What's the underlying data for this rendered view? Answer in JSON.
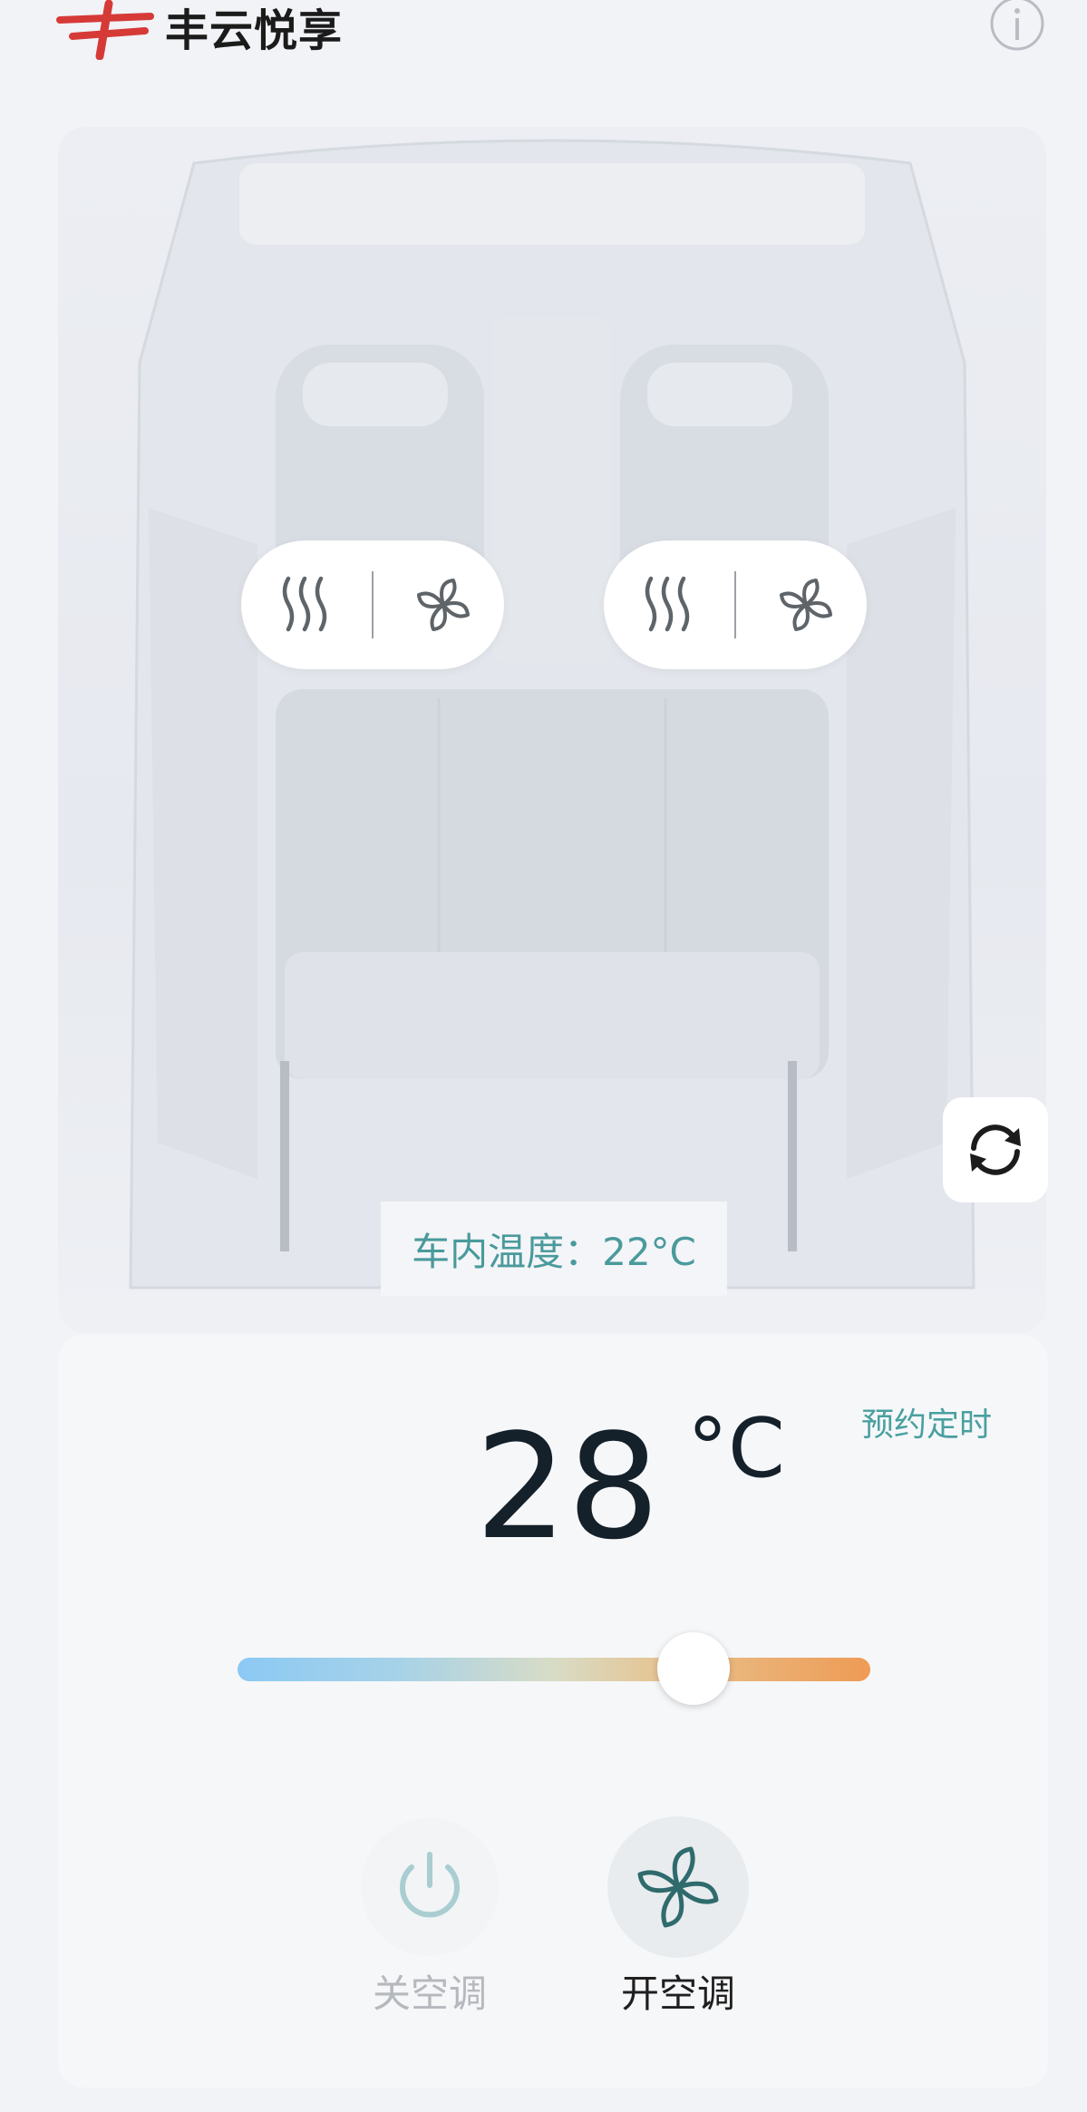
{
  "header": {
    "app_title": "丰云悦享",
    "logo_icon": "brand-logo",
    "info_icon": "info-icon"
  },
  "seat_controls": [
    {
      "heat_icon": "seat-heat-icon",
      "fan_icon": "seat-fan-icon"
    },
    {
      "heat_icon": "seat-heat-icon",
      "fan_icon": "seat-fan-icon"
    }
  ],
  "refresh_icon": "refresh-icon",
  "cabin_temperature": "车内温度：22°C",
  "panel": {
    "schedule_label": "预约定时",
    "temperature_value": "28",
    "temperature_unit": "°C",
    "slider_level": 0.72,
    "ac_off_label": "关空调",
    "ac_on_label": "开空调"
  },
  "colors": {
    "accent": "#4aa0a0",
    "brand": "#d63a37",
    "slider_cold": "#8cc9f4",
    "slider_hot": "#ee9b55"
  }
}
